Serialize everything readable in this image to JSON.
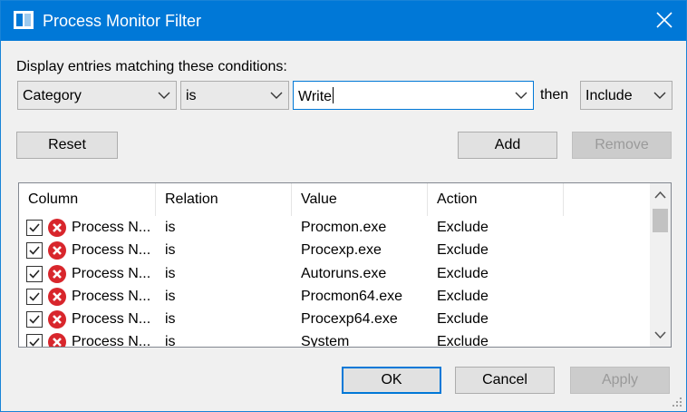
{
  "window": {
    "title": "Process Monitor Filter",
    "accent_color": "#0078d7",
    "icon": "procmon-app-icon"
  },
  "filter": {
    "label": "Display entries matching these conditions:",
    "column_value": "Category",
    "relation_value": "is",
    "value_text": "Write",
    "then_label": "then",
    "action_value": "Include"
  },
  "buttons": {
    "reset": "Reset",
    "add": "Add",
    "remove": "Remove",
    "ok": "OK",
    "cancel": "Cancel",
    "apply": "Apply"
  },
  "table": {
    "headers": [
      "Column",
      "Relation",
      "Value",
      "Action"
    ],
    "rows": [
      {
        "column": "Process N...",
        "relation": "is",
        "value": "Procmon.exe",
        "action": "Exclude"
      },
      {
        "column": "Process N...",
        "relation": "is",
        "value": "Procexp.exe",
        "action": "Exclude"
      },
      {
        "column": "Process N...",
        "relation": "is",
        "value": "Autoruns.exe",
        "action": "Exclude"
      },
      {
        "column": "Process N...",
        "relation": "is",
        "value": "Procmon64.exe",
        "action": "Exclude"
      },
      {
        "column": "Process N...",
        "relation": "is",
        "value": "Procexp64.exe",
        "action": "Exclude"
      },
      {
        "column": "Process N...",
        "relation": "is",
        "value": "System",
        "action": "Exclude"
      }
    ]
  }
}
